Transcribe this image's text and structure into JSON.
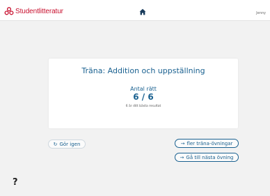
{
  "header": {
    "brand": "Studentlitteratur",
    "user": "Jenny"
  },
  "result": {
    "title": "Träna: Addition och uppställning",
    "score_label": "Antal rätt",
    "score_value": "6 / 6",
    "score_note": "6 är ditt bästa resultat"
  },
  "actions": {
    "retry": "Gör igen",
    "more": "fler träna-övningar",
    "next": "Gå till nästa övning"
  },
  "help": {
    "label": "?"
  },
  "colors": {
    "brand_red": "#c8102e",
    "accent_blue": "#1a6190",
    "background": "#f2f2f2"
  }
}
